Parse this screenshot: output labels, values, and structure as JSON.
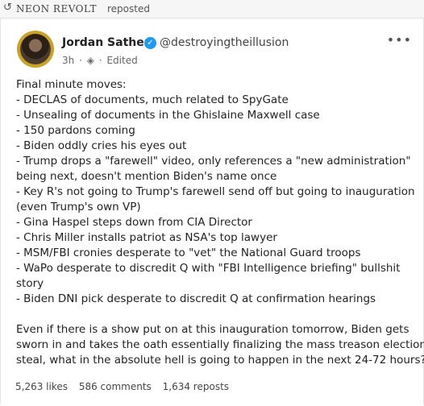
{
  "repost": {
    "icon": "repost-icon",
    "name": "NEON REVOLT",
    "label": "reposted"
  },
  "post": {
    "author": "Jordan Sather",
    "handle": "@destroyingtheillusion",
    "time": "3h",
    "edited": "Edited",
    "lines": [
      "Final minute moves:",
      "- DECLAS of documents, much related to SpyGate",
      "- Unsealing of documents in the Ghislaine Maxwell case",
      "- 150 pardons coming",
      "- Biden oddly cries his eyes out",
      "- Trump drops a \"farewell\" video, only references a \"new administration\"",
      "being next, doesn't mention Biden's name once",
      "- Key R's not going to Trump's farewell send off but going to inauguration",
      "(even Trump's own VP)",
      "- Gina Haspel steps down from CIA Director",
      "- Chris Miller installs patriot as NSA's top lawyer",
      "- MSM/FBI cronies desperate to \"vet\" the National Guard troops",
      "- WaPo desperate to discredit Q with \"FBI Intelligence briefing\" bullshit",
      "story",
      "- Biden DNI pick desperate to discredit Q at confirmation hearings"
    ],
    "closing_lines": [
      "Even if there is a show put on at this inauguration tomorrow, Biden gets",
      "sworn in and takes the oath essentially finalizing the mass treason election",
      "steal, what in the absolute hell is going to happen in the next 24-72 hours?"
    ]
  },
  "stats": {
    "likes": "5,263 likes",
    "comments": "586 comments",
    "reposts": "1,634 reposts"
  },
  "colors": {
    "verified": "#1d9bf0",
    "avatar_ring": "#c9a227"
  }
}
